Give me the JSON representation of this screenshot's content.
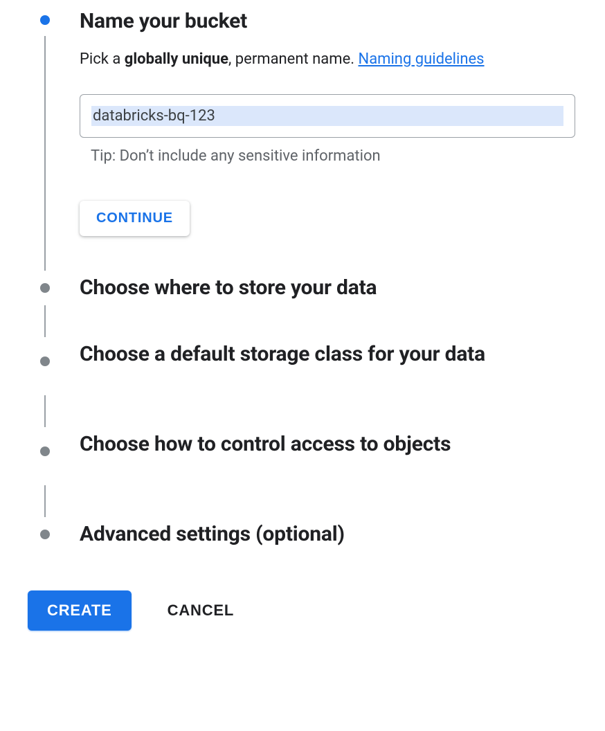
{
  "steps": {
    "name": {
      "title": "Name your bucket",
      "desc_prefix": "Pick a ",
      "desc_bold": "globally unique",
      "desc_suffix": ", permanent name. ",
      "guidelines_link": "Naming guidelines",
      "input_value": "databricks-bq-123",
      "tip": "Tip: Don’t include any sensitive information",
      "continue_label": "CONTINUE"
    },
    "location": {
      "title": "Choose where to store your data"
    },
    "storage_class": {
      "title": "Choose a default storage class for your data"
    },
    "access": {
      "title": "Choose how to control access to objects"
    },
    "advanced": {
      "title": "Advanced settings (optional)"
    }
  },
  "footer": {
    "create_label": "CREATE",
    "cancel_label": "CANCEL"
  }
}
